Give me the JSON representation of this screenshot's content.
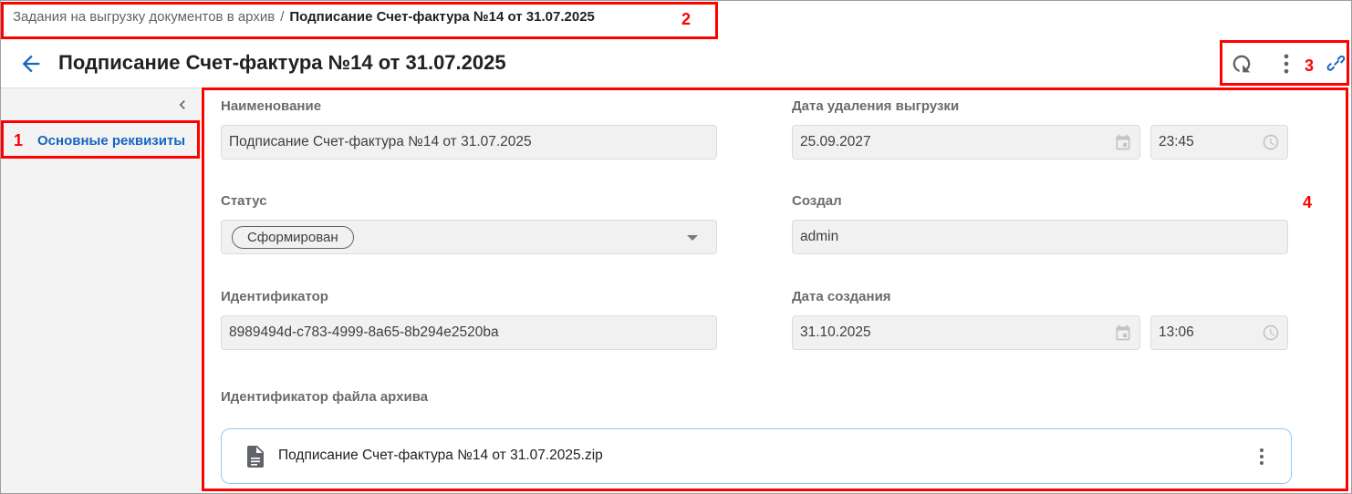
{
  "breadcrumb": {
    "parent": "Задания на выгрузку документов в архив",
    "separator": "/",
    "current": "Подписание Счет-фактура №14 от 31.07.2025"
  },
  "header": {
    "title": "Подписание Счет-фактура №14 от 31.07.2025",
    "icons": [
      "back-arrow-icon",
      "refresh-icon",
      "more-vertical-icon",
      "link-icon"
    ]
  },
  "sidebar": {
    "items": [
      {
        "label": "Основные реквизиты",
        "active": true
      }
    ]
  },
  "form": {
    "name": {
      "label": "Наименование",
      "value": "Подписание Счет-фактура №14 от 31.07.2025"
    },
    "status": {
      "label": "Статус",
      "value": "Сформирован"
    },
    "identifier": {
      "label": "Идентификатор",
      "value": "8989494d-c783-4999-8a65-8b294e2520ba"
    },
    "delete_date": {
      "label": "Дата удаления выгрузки",
      "date": "25.09.2027",
      "time": "23:45"
    },
    "created_by": {
      "label": "Создал",
      "value": "admin"
    },
    "created_date": {
      "label": "Дата создания",
      "date": "31.10.2025",
      "time": "13:06"
    },
    "archive_file": {
      "label": "Идентификатор файла архива",
      "file_name": "Подписание Счет-фактура №14 от 31.07.2025.zip"
    }
  },
  "annotations": [
    "1",
    "2",
    "3",
    "4"
  ],
  "colors": {
    "accent": "#1565c0",
    "annotation": "#ff0000",
    "field_bg": "#f1f1f1",
    "sidebar_bg": "#f3f3f3",
    "file_card_border": "#90caf9"
  }
}
